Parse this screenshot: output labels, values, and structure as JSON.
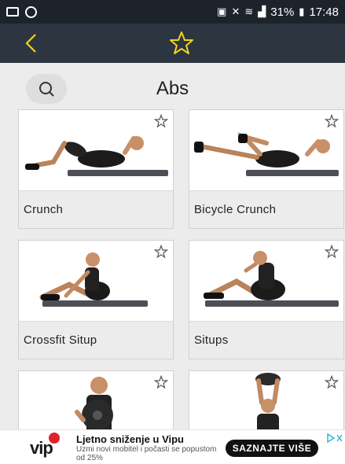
{
  "status_bar": {
    "battery_pct": "31%",
    "time": "17:48"
  },
  "app_bar": {
    "back_icon": "chevron-left-icon",
    "favorite_icon": "star-outline-icon",
    "accent_color": "#f2d21a"
  },
  "header": {
    "search_icon": "search-icon",
    "title": "Abs"
  },
  "exercises": [
    {
      "label": "Crunch"
    },
    {
      "label": "Bicycle Crunch"
    },
    {
      "label": "Crossfit Situp"
    },
    {
      "label": "Situps"
    },
    {
      "label": ""
    },
    {
      "label": ""
    }
  ],
  "ad": {
    "brand": "vip",
    "title": "Ljetno sniženje u Vipu",
    "subtitle": "Uzmi novi mobitel i počasti se popustom od 25%",
    "cta": "SAZNAJTE VIŠE"
  }
}
